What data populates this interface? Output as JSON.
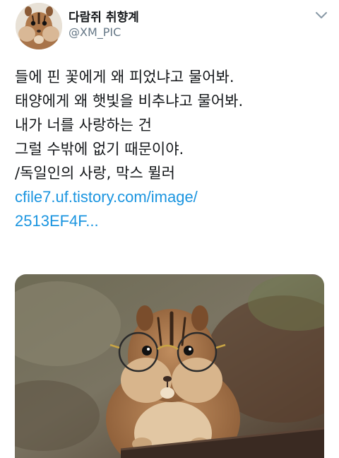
{
  "user": {
    "display_name": "다람쥐 취향계",
    "handle": "@XM_PIC",
    "avatar_icon": "chipmunk-avatar"
  },
  "menu_icon": "chevron-down-icon",
  "tweet": {
    "lines": [
      "들에 핀 꽃에게 왜 피었냐고 물어봐.",
      "태양에게 왜 햇빛을 비추냐고 물어봐.",
      "내가 너를 사랑하는 건",
      "그럴 수밖에 없기 때문이야.",
      "/독일인의 사랑, 막스 뮐러"
    ],
    "link_lines": [
      "cfile7.uf.tistory.com/image/",
      "2513EF4F..."
    ]
  },
  "media": {
    "subject": "chipmunk-with-glasses-photo"
  },
  "colors": {
    "link": "#1b95e0",
    "handle": "#657786",
    "text": "#14171a"
  }
}
